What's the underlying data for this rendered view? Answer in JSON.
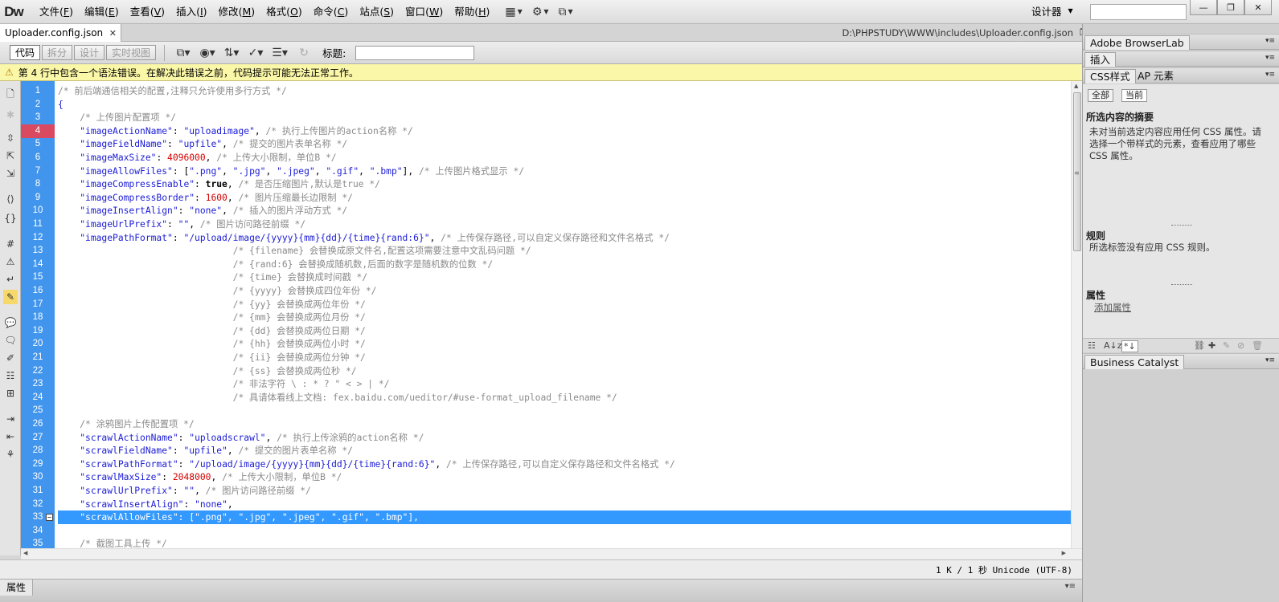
{
  "app": {
    "logo": "Dw",
    "menus": [
      {
        "label": "文件",
        "key": "F"
      },
      {
        "label": "编辑",
        "key": "E"
      },
      {
        "label": "查看",
        "key": "V"
      },
      {
        "label": "插入",
        "key": "I"
      },
      {
        "label": "修改",
        "key": "M"
      },
      {
        "label": "格式",
        "key": "O"
      },
      {
        "label": "命令",
        "key": "C"
      },
      {
        "label": "站点",
        "key": "S"
      },
      {
        "label": "窗口",
        "key": "W"
      },
      {
        "label": "帮助",
        "key": "H"
      }
    ],
    "toolbar_dropdowns": [
      "layout-icon",
      "gear-icon",
      "site-icon"
    ],
    "workspace_label": "设计器"
  },
  "document": {
    "tab_label": "Uploader.config.json",
    "path": "D:\\PHPSTUDY\\WWW\\includes\\Uploader.config.json",
    "views": [
      "代码",
      "拆分",
      "设计",
      "实时视图"
    ],
    "active_view": "代码",
    "title_label": "标题:",
    "title_value": ""
  },
  "error": {
    "message": "第 4 行中包含一个语法错误。在解决此错误之前，代码提示可能无法正常工作。"
  },
  "code": {
    "error_line": 4,
    "selected_line": 33,
    "fold_line": 33,
    "lines": [
      [
        [
          "c",
          "/* 前后端通信相关的配置,注释只允许使用多行方式 */"
        ]
      ],
      [
        [
          "k",
          "{"
        ]
      ],
      [
        [
          "p",
          "    "
        ],
        [
          "c",
          "/* 上传图片配置项 */"
        ]
      ],
      [
        [
          "p",
          "    "
        ],
        [
          "k",
          "\"imageActionName\""
        ],
        [
          "p",
          ": "
        ],
        [
          "k",
          "\"uploadimage\""
        ],
        [
          "p",
          ", "
        ],
        [
          "c",
          "/* 执行上传图片的action名称 */"
        ]
      ],
      [
        [
          "p",
          "    "
        ],
        [
          "k",
          "\"imageFieldName\""
        ],
        [
          "p",
          ": "
        ],
        [
          "k",
          "\"upfile\""
        ],
        [
          "p",
          ", "
        ],
        [
          "c",
          "/* 提交的图片表单名称 */"
        ]
      ],
      [
        [
          "p",
          "    "
        ],
        [
          "k",
          "\"imageMaxSize\""
        ],
        [
          "p",
          ": "
        ],
        [
          "n",
          "4096000"
        ],
        [
          "p",
          ", "
        ],
        [
          "c",
          "/* 上传大小限制，单位B */"
        ]
      ],
      [
        [
          "p",
          "    "
        ],
        [
          "k",
          "\"imageAllowFiles\""
        ],
        [
          "p",
          ": ["
        ],
        [
          "k",
          "\".png\""
        ],
        [
          "p",
          ", "
        ],
        [
          "k",
          "\".jpg\""
        ],
        [
          "p",
          ", "
        ],
        [
          "k",
          "\".jpeg\""
        ],
        [
          "p",
          ", "
        ],
        [
          "k",
          "\".gif\""
        ],
        [
          "p",
          ", "
        ],
        [
          "k",
          "\".bmp\""
        ],
        [
          "p",
          "], "
        ],
        [
          "c",
          "/* 上传图片格式显示 */"
        ]
      ],
      [
        [
          "p",
          "    "
        ],
        [
          "k",
          "\"imageCompressEnable\""
        ],
        [
          "p",
          ": "
        ],
        [
          "b",
          "true"
        ],
        [
          "p",
          ", "
        ],
        [
          "c",
          "/* 是否压缩图片,默认是true */"
        ]
      ],
      [
        [
          "p",
          "    "
        ],
        [
          "k",
          "\"imageCompressBorder\""
        ],
        [
          "p",
          ": "
        ],
        [
          "n",
          "1600"
        ],
        [
          "p",
          ", "
        ],
        [
          "c",
          "/* 图片压缩最长边限制 */"
        ]
      ],
      [
        [
          "p",
          "    "
        ],
        [
          "k",
          "\"imageInsertAlign\""
        ],
        [
          "p",
          ": "
        ],
        [
          "k",
          "\"none\""
        ],
        [
          "p",
          ", "
        ],
        [
          "c",
          "/* 插入的图片浮动方式 */"
        ]
      ],
      [
        [
          "p",
          "    "
        ],
        [
          "k",
          "\"imageUrlPrefix\""
        ],
        [
          "p",
          ": "
        ],
        [
          "k",
          "\"\""
        ],
        [
          "p",
          ", "
        ],
        [
          "c",
          "/* 图片访问路径前缀 */"
        ]
      ],
      [
        [
          "p",
          "    "
        ],
        [
          "k",
          "\"imagePathFormat\""
        ],
        [
          "p",
          ": "
        ],
        [
          "k",
          "\"/upload/image/{yyyy}{mm}{dd}/{time}{rand:6}\""
        ],
        [
          "p",
          ", "
        ],
        [
          "c",
          "/* 上传保存路径,可以自定义保存路径和文件名格式 */"
        ]
      ],
      [
        [
          "p",
          "                                "
        ],
        [
          "c",
          "/* {filename} 会替换成原文件名,配置这项需要注意中文乱码问题 */"
        ]
      ],
      [
        [
          "p",
          "                                "
        ],
        [
          "c",
          "/* {rand:6} 会替换成随机数,后面的数字是随机数的位数 */"
        ]
      ],
      [
        [
          "p",
          "                                "
        ],
        [
          "c",
          "/* {time} 会替换成时间戳 */"
        ]
      ],
      [
        [
          "p",
          "                                "
        ],
        [
          "c",
          "/* {yyyy} 会替换成四位年份 */"
        ]
      ],
      [
        [
          "p",
          "                                "
        ],
        [
          "c",
          "/* {yy} 会替换成两位年份 */"
        ]
      ],
      [
        [
          "p",
          "                                "
        ],
        [
          "c",
          "/* {mm} 会替换成两位月份 */"
        ]
      ],
      [
        [
          "p",
          "                                "
        ],
        [
          "c",
          "/* {dd} 会替换成两位日期 */"
        ]
      ],
      [
        [
          "p",
          "                                "
        ],
        [
          "c",
          "/* {hh} 会替换成两位小时 */"
        ]
      ],
      [
        [
          "p",
          "                                "
        ],
        [
          "c",
          "/* {ii} 会替换成两位分钟 */"
        ]
      ],
      [
        [
          "p",
          "                                "
        ],
        [
          "c",
          "/* {ss} 会替换成两位秒 */"
        ]
      ],
      [
        [
          "p",
          "                                "
        ],
        [
          "c",
          "/* 非法字符 \\ : * ? \" < > | */"
        ]
      ],
      [
        [
          "p",
          "                                "
        ],
        [
          "c",
          "/* 具请体看线上文档: fex.baidu.com/ueditor/#use-format_upload_filename */"
        ]
      ],
      [
        [
          "p",
          ""
        ]
      ],
      [
        [
          "p",
          "    "
        ],
        [
          "c",
          "/* 涂鸦图片上传配置项 */"
        ]
      ],
      [
        [
          "p",
          "    "
        ],
        [
          "k",
          "\"scrawlActionName\""
        ],
        [
          "p",
          ": "
        ],
        [
          "k",
          "\"uploadscrawl\""
        ],
        [
          "p",
          ", "
        ],
        [
          "c",
          "/* 执行上传涂鸦的action名称 */"
        ]
      ],
      [
        [
          "p",
          "    "
        ],
        [
          "k",
          "\"scrawlFieldName\""
        ],
        [
          "p",
          ": "
        ],
        [
          "k",
          "\"upfile\""
        ],
        [
          "p",
          ", "
        ],
        [
          "c",
          "/* 提交的图片表单名称 */"
        ]
      ],
      [
        [
          "p",
          "    "
        ],
        [
          "k",
          "\"scrawlPathFormat\""
        ],
        [
          "p",
          ": "
        ],
        [
          "k",
          "\"/upload/image/{yyyy}{mm}{dd}/{time}{rand:6}\""
        ],
        [
          "p",
          ", "
        ],
        [
          "c",
          "/* 上传保存路径,可以自定义保存路径和文件名格式 */"
        ]
      ],
      [
        [
          "p",
          "    "
        ],
        [
          "k",
          "\"scrawlMaxSize\""
        ],
        [
          "p",
          ": "
        ],
        [
          "n",
          "2048000"
        ],
        [
          "p",
          ", "
        ],
        [
          "c",
          "/* 上传大小限制，单位B */"
        ]
      ],
      [
        [
          "p",
          "    "
        ],
        [
          "k",
          "\"scrawlUrlPrefix\""
        ],
        [
          "p",
          ": "
        ],
        [
          "k",
          "\"\""
        ],
        [
          "p",
          ", "
        ],
        [
          "c",
          "/* 图片访问路径前缀 */"
        ]
      ],
      [
        [
          "p",
          "    "
        ],
        [
          "k",
          "\"scrawlInsertAlign\""
        ],
        [
          "p",
          ": "
        ],
        [
          "k",
          "\"none\""
        ],
        [
          "p",
          ","
        ]
      ],
      [
        [
          "p",
          "    "
        ],
        [
          "k",
          "\"scrawlAllowFiles\""
        ],
        [
          "p",
          ": ["
        ],
        [
          "k",
          "\".png\""
        ],
        [
          "p",
          ", "
        ],
        [
          "k",
          "\".jpg\""
        ],
        [
          "p",
          ", "
        ],
        [
          "k",
          "\".jpeg\""
        ],
        [
          "p",
          ", "
        ],
        [
          "k",
          "\".gif\""
        ],
        [
          "p",
          ", "
        ],
        [
          "k",
          "\".bmp\""
        ],
        [
          "p",
          "],"
        ]
      ],
      [
        [
          "p",
          ""
        ]
      ],
      [
        [
          "p",
          "    "
        ],
        [
          "c",
          "/* 截图工具上传 */"
        ]
      ]
    ]
  },
  "status": {
    "text": "1 K / 1 秒 Unicode (UTF-8)"
  },
  "properties_bar": {
    "label": "属性"
  },
  "panels": {
    "browserlab_tab": "Adobe BrowserLab",
    "insert_tab": "插入",
    "css_tabs": [
      "CSS样式",
      "AP 元素"
    ],
    "css_buttons": [
      "全部",
      "当前"
    ],
    "summary_title": "所选内容的摘要",
    "summary_body": "未对当前选定内容应用任何 CSS 属性。请选择一个带样式的元素，查看应用了哪些 CSS 属性。",
    "rules_title": "规则",
    "rules_body": "所选标签没有应用 CSS 规则。",
    "props_title": "属性",
    "add_property": "添加属性",
    "business_tab": "Business Catalyst"
  },
  "colors": {
    "gutter": "#4195ec",
    "error_line": "#d94a60",
    "selection": "#3399ff",
    "keyword": "#1b1bd6",
    "number": "#d40000",
    "comment": "#8a8a8a",
    "error_bar": "#fbf7a8"
  }
}
